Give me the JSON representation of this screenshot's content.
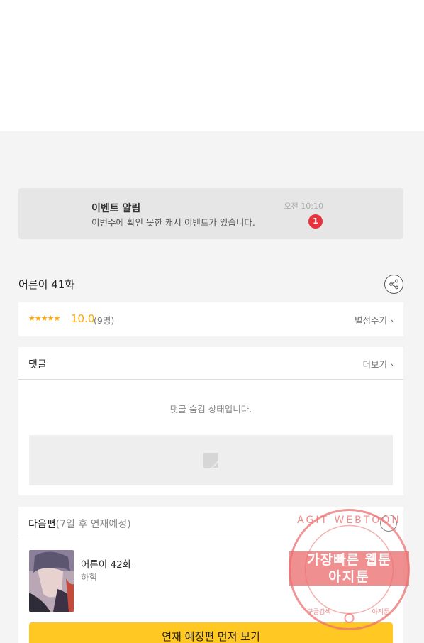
{
  "event": {
    "title": "이벤트 알림",
    "message": "이번주에 확인 못한 캐시 이벤트가 있습니다.",
    "time": "오전 10:10",
    "badge_count": "1"
  },
  "episode": {
    "title": "어른이 41화",
    "share_icon": "share-icon"
  },
  "rating": {
    "stars": "★★★★★",
    "score": "10.0",
    "count": "(9명)",
    "rate_label": "별점주기 ›"
  },
  "comments": {
    "title": "댓글",
    "more_label": "더보기 ›",
    "hidden_message": "댓글 숨김 상태입니다."
  },
  "next": {
    "title": "다음편",
    "subtitle": "(7일 후 연재예정)",
    "episode_name": "어른이 42화",
    "author": "하힘",
    "preview_button": "연재 예정편 먼저 보기"
  },
  "watermark": {
    "line1": "가장빠른 웹툰",
    "line2": "아지툰",
    "ring_text": "AGIT WEBTOON",
    "ring_bottom_left": "구글검색",
    "ring_bottom_right": "아지툰"
  },
  "colors": {
    "accent": "#ffa800",
    "badge": "#e8313a",
    "button": "#ffc823",
    "watermark": "#ec7070"
  }
}
